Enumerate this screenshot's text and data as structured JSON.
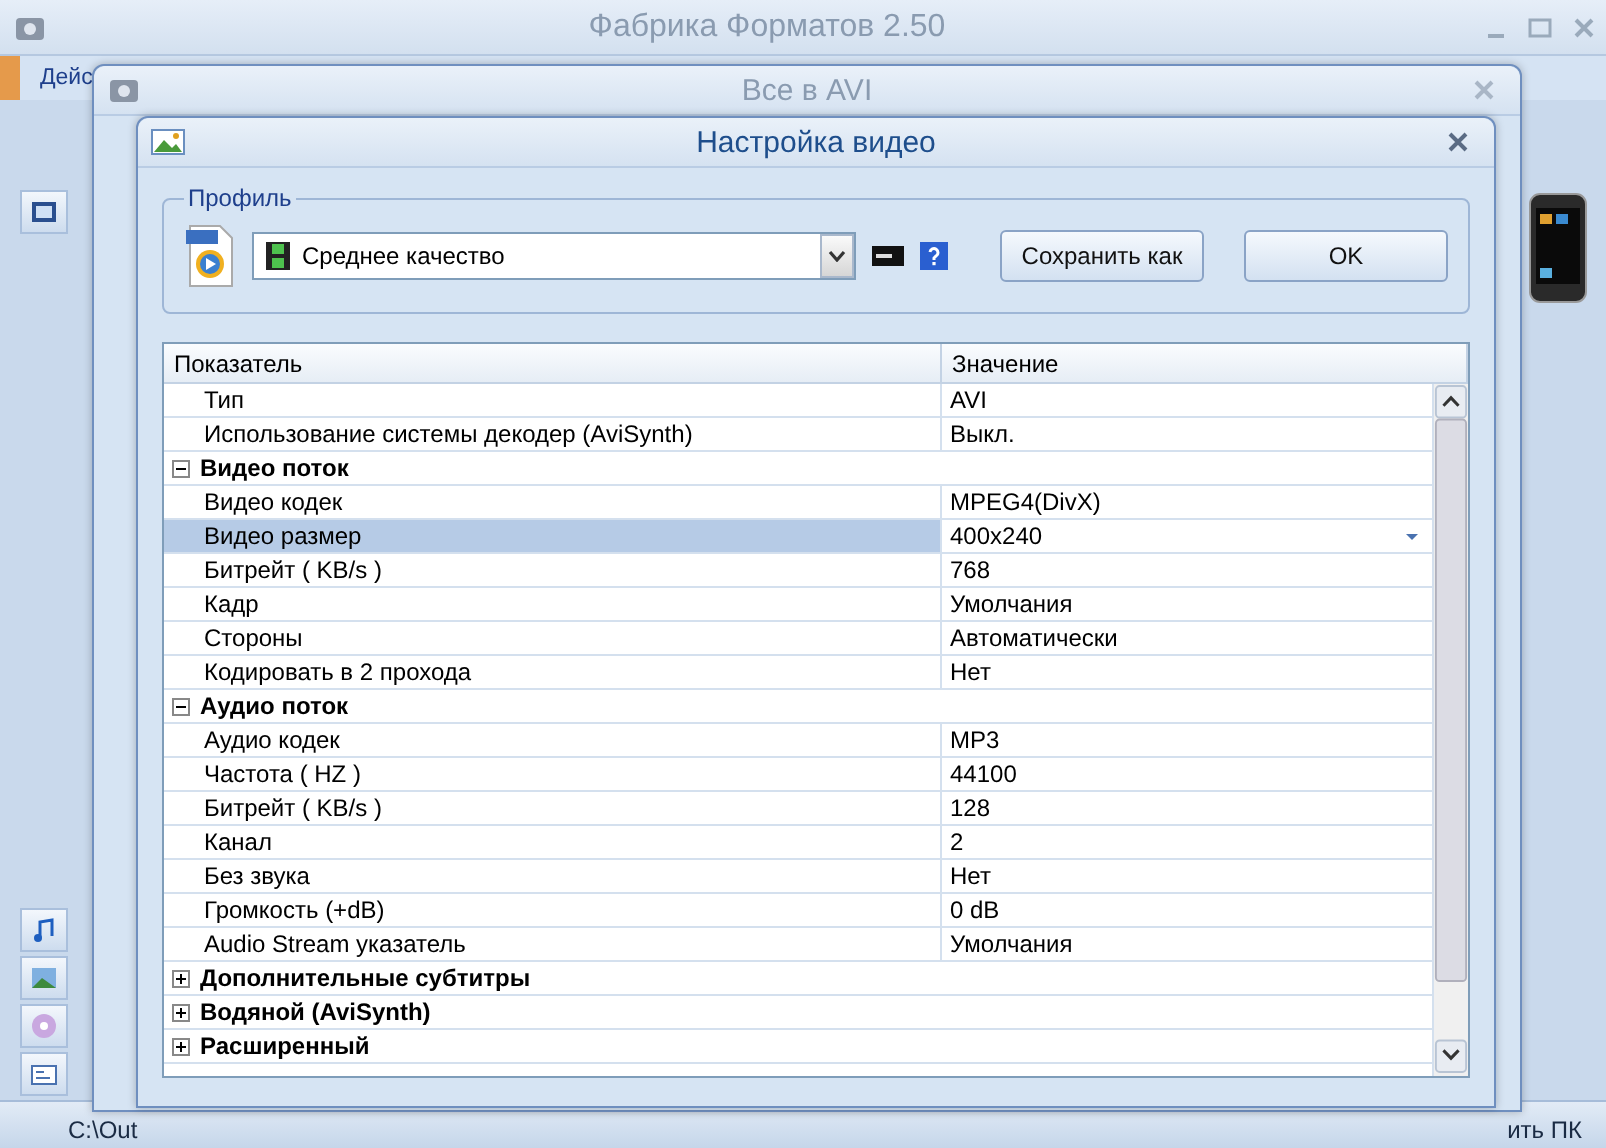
{
  "main_window": {
    "title": "Фабрика Форматов 2.50",
    "menu_fragment": "Дейс",
    "status_path": "C:\\Out",
    "status_right": "ить ПК"
  },
  "sub_window": {
    "title": "Все в AVI"
  },
  "dialog": {
    "title": "Настройка видео",
    "profile": {
      "label": "Профиль",
      "value": "Среднее качество",
      "buttons": [
        "Сохранить как",
        "OK"
      ]
    },
    "table": {
      "columns": [
        "Показатель",
        "Значение"
      ],
      "rows": [
        {
          "kind": "prop",
          "label": "Тип",
          "value": "AVI",
          "selected": false
        },
        {
          "kind": "prop",
          "label": "Использование системы декодер (AviSynth)",
          "value": "Выкл.",
          "selected": false
        },
        {
          "kind": "group",
          "label": "Видео поток",
          "expanded": true,
          "children": [
            {
              "kind": "prop",
              "label": "Видео кодек",
              "value": "MPEG4(DivX)",
              "selected": false
            },
            {
              "kind": "prop",
              "label": "Видео размер",
              "value": "400x240",
              "selected": true
            },
            {
              "kind": "prop",
              "label": "Битрейт ( KB/s )",
              "value": "768",
              "selected": false
            },
            {
              "kind": "prop",
              "label": "Кадр",
              "value": "Умолчания",
              "selected": false
            },
            {
              "kind": "prop",
              "label": "Стороны",
              "value": "Автоматически",
              "selected": false
            },
            {
              "kind": "prop",
              "label": "Кодировать в 2 прохода",
              "value": "Нет",
              "selected": false
            }
          ]
        },
        {
          "kind": "group",
          "label": "Аудио поток",
          "expanded": true,
          "children": [
            {
              "kind": "prop",
              "label": "Аудио кодек",
              "value": "MP3",
              "selected": false
            },
            {
              "kind": "prop",
              "label": "Частота ( HZ )",
              "value": "44100",
              "selected": false
            },
            {
              "kind": "prop",
              "label": "Битрейт ( KB/s )",
              "value": "128",
              "selected": false
            },
            {
              "kind": "prop",
              "label": "Канал",
              "value": "2",
              "selected": false
            },
            {
              "kind": "prop",
              "label": "Без звука",
              "value": "Нет",
              "selected": false
            },
            {
              "kind": "prop",
              "label": "Громкость (+dB)",
              "value": "0 dB",
              "selected": false
            },
            {
              "kind": "prop",
              "label": "Audio Stream указатель",
              "value": "Умолчания",
              "selected": false
            }
          ]
        },
        {
          "kind": "group",
          "label": "Дополнительные субтитры",
          "expanded": false
        },
        {
          "kind": "group",
          "label": "Водяной (AviSynth)",
          "expanded": false
        },
        {
          "kind": "group",
          "label": "Расширенный",
          "expanded": false
        }
      ]
    }
  }
}
